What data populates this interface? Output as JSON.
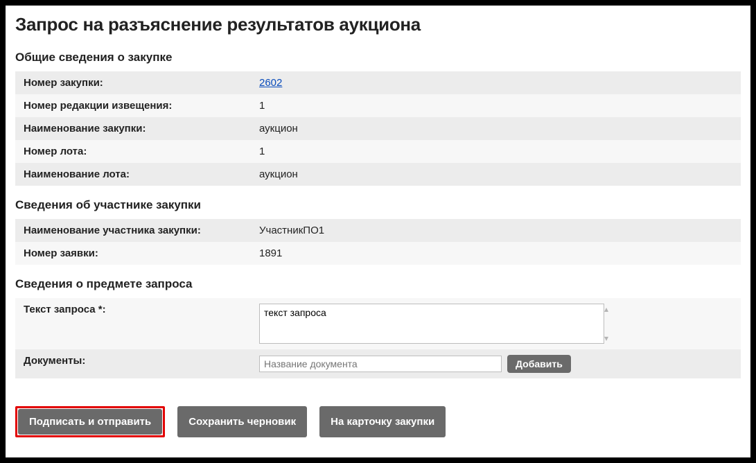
{
  "page_title": "Запрос на разъяснение результатов аукциона",
  "sections": {
    "general": {
      "heading": "Общие сведения о закупке",
      "rows": {
        "purchase_number_label": "Номер закупки:",
        "purchase_number_value": "2602",
        "notice_revision_label": "Номер редакции извещения:",
        "notice_revision_value": "1",
        "purchase_name_label": "Наименование закупки:",
        "purchase_name_value": "аукцион",
        "lot_number_label": "Номер лота:",
        "lot_number_value": "1",
        "lot_name_label": "Наименование лота:",
        "lot_name_value": "аукцион"
      }
    },
    "participant": {
      "heading": "Сведения об участнике закупки",
      "rows": {
        "participant_name_label": "Наименование участника закупки:",
        "participant_name_value": "УчастникПО1",
        "application_number_label": "Номер заявки:",
        "application_number_value": "1891"
      }
    },
    "request": {
      "heading": "Сведения о предмете запроса",
      "text_label": "Текст запроса *:",
      "text_value": "текст запроса",
      "documents_label": "Документы:",
      "documents_placeholder": "Название документа",
      "add_button": "Добавить"
    }
  },
  "actions": {
    "sign_send": "Подписать и отправить",
    "save_draft": "Сохранить черновик",
    "to_card": "На карточку закупки"
  }
}
